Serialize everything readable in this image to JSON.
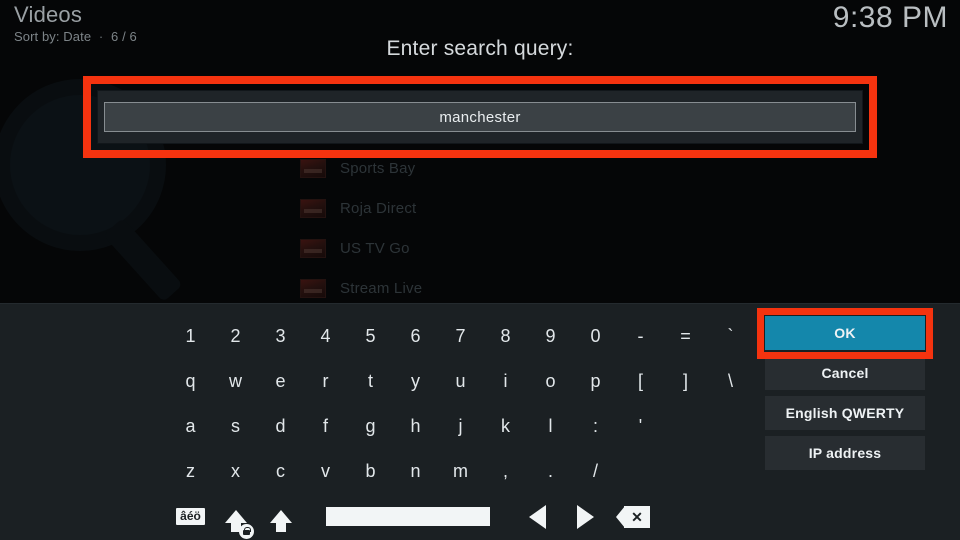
{
  "window": {
    "title": "Videos",
    "subtitle_prefix": "Sort by: Date",
    "subtitle_separator": "·",
    "subtitle_count": "6 / 6",
    "clock": "9:38 PM"
  },
  "background_list": {
    "items": [
      {
        "label": "Stream Live",
        "icon": "media-thumbnail-icon"
      },
      {
        "label": "Sports Bay",
        "icon": "media-thumbnail-icon"
      },
      {
        "label": "Roja Direct",
        "icon": "media-thumbnail-icon"
      },
      {
        "label": "US TV Go",
        "icon": "media-thumbnail-icon"
      }
    ]
  },
  "dialog": {
    "heading": "Enter search query:",
    "input": {
      "value": "manchester",
      "placeholder": ""
    }
  },
  "keyboard": {
    "rows": [
      [
        "1",
        "2",
        "3",
        "4",
        "5",
        "6",
        "7",
        "8",
        "9",
        "0",
        "-",
        "=",
        "`"
      ],
      [
        "q",
        "w",
        "e",
        "r",
        "t",
        "y",
        "u",
        "i",
        "o",
        "p",
        "[",
        "]",
        "\\"
      ],
      [
        "a",
        "s",
        "d",
        "f",
        "g",
        "h",
        "j",
        "k",
        "l",
        ":",
        "'"
      ],
      [
        "z",
        "x",
        "c",
        "v",
        "b",
        "n",
        "m",
        ",",
        ".",
        "/"
      ]
    ],
    "function_row": {
      "accent_label": "âéö",
      "caps_lock_icon": "caps-lock-arrow-icon",
      "shift_icon": "shift-arrow-icon",
      "space_icon": "space-bar-icon",
      "cursor_left_icon": "arrow-left-icon",
      "cursor_right_icon": "arrow-right-icon",
      "backspace_icon": "backspace-icon"
    }
  },
  "side_buttons": [
    {
      "label": "OK",
      "style": "primary"
    },
    {
      "label": "Cancel",
      "style": "default"
    },
    {
      "label": "English QWERTY",
      "style": "default"
    },
    {
      "label": "IP address",
      "style": "default"
    }
  ],
  "annotations": {
    "color": "#f5330f",
    "targets": [
      "search-input",
      "ok-button"
    ]
  },
  "colors": {
    "accent_blue": "#1487ab",
    "panel_bg": "#1b2023",
    "button_bg": "#282d31",
    "input_bg": "#3b4145",
    "highlight_red": "#f5330f"
  }
}
